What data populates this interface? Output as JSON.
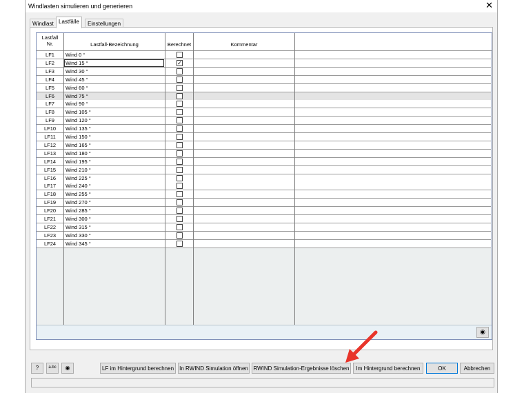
{
  "window": {
    "title": "Windlasten simulieren und generieren",
    "close_glyph": "✕"
  },
  "tabs": [
    {
      "label": "Windlast",
      "active": false
    },
    {
      "label": "Lastfälle",
      "active": true
    },
    {
      "label": "Einstellungen",
      "active": false
    }
  ],
  "table": {
    "headers": {
      "nr_line1": "Lastfall",
      "nr_line2": "Nr.",
      "name": "Lastfall-Bezeichnung",
      "calculated": "Berechnet",
      "comment": "Kommentar"
    },
    "rows": [
      {
        "nr": "LF1",
        "name": "Wind 0 °",
        "checked": false
      },
      {
        "nr": "LF2",
        "name": "Wind 15 °",
        "checked": true,
        "editing": true
      },
      {
        "nr": "LF3",
        "name": "Wind 30 °",
        "checked": false
      },
      {
        "nr": "LF4",
        "name": "Wind 45 °",
        "checked": false
      },
      {
        "nr": "LF5",
        "name": "Wind 60 °",
        "checked": false
      },
      {
        "nr": "LF6",
        "name": "Wind 75 °",
        "checked": false,
        "highlighted": true
      },
      {
        "nr": "LF7",
        "name": "Wind 90 °",
        "checked": false
      },
      {
        "nr": "LF8",
        "name": "Wind 105 °",
        "checked": false
      },
      {
        "nr": "LF9",
        "name": "Wind 120 °",
        "checked": false
      },
      {
        "nr": "LF10",
        "name": "Wind 135 °",
        "checked": false
      },
      {
        "nr": "LF11",
        "name": "Wind 150 °",
        "checked": false
      },
      {
        "nr": "LF12",
        "name": "Wind 165 °",
        "checked": false
      },
      {
        "nr": "LF13",
        "name": "Wind 180 °",
        "checked": false
      },
      {
        "nr": "LF14",
        "name": "Wind 195 °",
        "checked": false
      },
      {
        "nr": "LF15",
        "name": "Wind 210 °",
        "checked": false
      },
      {
        "nr": "LF16",
        "name": "Wind 225 °",
        "checked": false
      },
      {
        "nr": "LF17",
        "name": "Wind 240 °",
        "checked": false
      },
      {
        "nr": "LF18",
        "name": "Wind 255 °",
        "checked": false
      },
      {
        "nr": "LF19",
        "name": "Wind 270 °",
        "checked": false
      },
      {
        "nr": "LF20",
        "name": "Wind 285 °",
        "checked": false
      },
      {
        "nr": "LF21",
        "name": "Wind 300 °",
        "checked": false
      },
      {
        "nr": "LF22",
        "name": "Wind 315 °",
        "checked": false
      },
      {
        "nr": "LF23",
        "name": "Wind 330 °",
        "checked": false
      },
      {
        "nr": "LF24",
        "name": "Wind 345 °",
        "checked": false
      }
    ]
  },
  "icons": {
    "help": "help-icon",
    "units": "units-icon",
    "view": "eye-icon",
    "grid_view": "eye-icon",
    "help_glyph": "?",
    "units_glyph": "a.bc",
    "eye_glyph": "◉"
  },
  "buttons": {
    "lf_background": "LF  im Hintergrund berechnen",
    "open_rwind": "In RWIND Simulation öffnen",
    "delete_results": "RWIND Simulation-Ergebnisse löschen",
    "background": "Im Hintergrund berechnen",
    "ok": "OK",
    "cancel": "Abbrechen"
  },
  "colors": {
    "annotation_arrow": "#e8352b",
    "grid_border": "#7f8fb8",
    "ok_border": "#0078d7"
  }
}
